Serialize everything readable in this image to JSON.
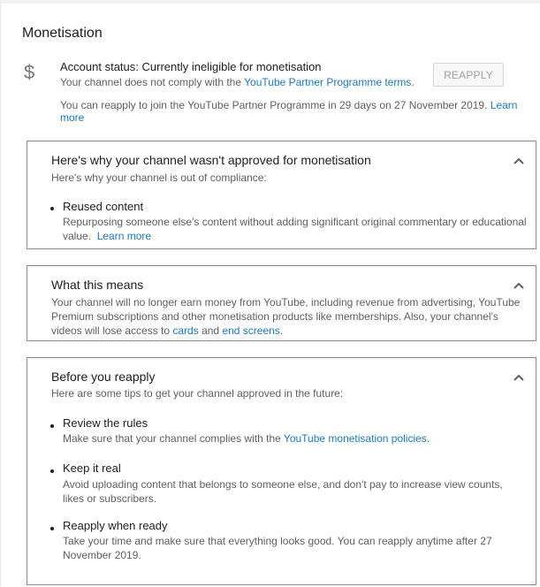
{
  "page": {
    "title": "Monetisation"
  },
  "status": {
    "icon": "dollar-icon",
    "title": "Account status: Currently ineligible for monetisation",
    "desc_prefix": "Your channel does not comply with the ",
    "desc_link": "YouTube Partner Programme terms",
    "desc_suffix": ".",
    "reapply_button": "REAPPLY",
    "note": "You can reapply to join the YouTube Partner Programme in 29 days on 27 November 2019.",
    "note_link": "Learn more"
  },
  "why_panel": {
    "title": "Here's why your channel wasn't approved for monetisation",
    "subtitle": "Here's why your channel is out of compliance:",
    "items": [
      {
        "title": "Reused content",
        "desc": "Repurposing someone else's content without adding significant original commentary or educational value.",
        "link": "Learn more"
      }
    ]
  },
  "means_panel": {
    "title": "What this means",
    "text": "Your channel will no longer earn money from YouTube, including revenue from advertising, YouTube Premium subscriptions and other monetisation products like memberships. Also, your channel's videos will lose access to ",
    "link1": "cards",
    "mid": " and ",
    "link2": "end screens",
    "end": "."
  },
  "before_panel": {
    "title": "Before you reapply",
    "subtitle": "Here are some tips to get your channel approved in the future:",
    "items": [
      {
        "title": "Review the rules",
        "desc_prefix": "Make sure that your channel complies with the ",
        "link": "YouTube monetisation policies",
        "desc_suffix": "."
      },
      {
        "title": "Keep it real",
        "desc": "Avoid uploading content that belongs to someone else, and don't pay to increase view counts, likes or subscribers."
      },
      {
        "title": "Reapply when ready",
        "desc": "Take your time and make sure that everything looks good. You can reapply anytime after 27 November 2019."
      }
    ]
  },
  "colors": {
    "link": "#167ac6",
    "secondary_text": "#606060",
    "border": "#8a8a8a"
  }
}
